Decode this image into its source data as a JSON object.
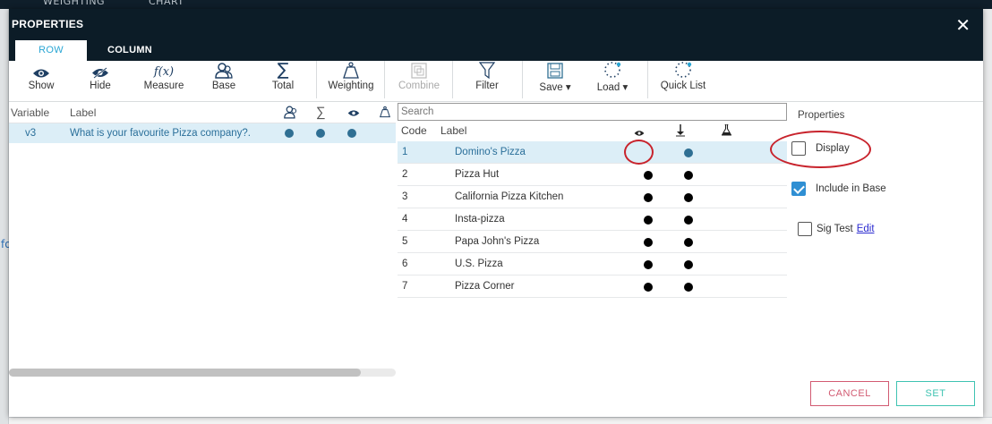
{
  "backdrop": {
    "tabs": [
      "WEIGHTING",
      "CHART"
    ],
    "side_link": "fo"
  },
  "modal": {
    "title": "PROPERTIES",
    "tabs": [
      {
        "label": "ROW",
        "active": true
      },
      {
        "label": "COLUMN",
        "active": false
      }
    ]
  },
  "toolbar": {
    "show": "Show",
    "hide": "Hide",
    "measure": "Measure",
    "measure_icon_text": "f(x)",
    "base": "Base",
    "total": "Total",
    "weighting": "Weighting",
    "combine": "Combine",
    "filter": "Filter",
    "save": "Save ▾",
    "load": "Load ▾",
    "quick_list": "Quick List"
  },
  "variables": {
    "headers": {
      "variable": "Variable",
      "label": "Label"
    },
    "rows": [
      {
        "variable": "v3",
        "label": "What is your favourite Pizza company?."
      }
    ]
  },
  "grid": {
    "search_placeholder": "Search",
    "headers": {
      "code": "Code",
      "label": "Label"
    },
    "rows": [
      {
        "code": "1",
        "label": "Domino's Pizza",
        "selected": true
      },
      {
        "code": "2",
        "label": "Pizza Hut"
      },
      {
        "code": "3",
        "label": "California Pizza Kitchen"
      },
      {
        "code": "4",
        "label": "Insta-pizza"
      },
      {
        "code": "5",
        "label": "Papa John's Pizza"
      },
      {
        "code": "6",
        "label": "U.S. Pizza"
      },
      {
        "code": "7",
        "label": "Pizza Corner"
      }
    ]
  },
  "properties": {
    "title": "Properties",
    "display": {
      "label": "Display",
      "checked": false
    },
    "include_in_base": {
      "label": "Include in Base",
      "checked": true
    },
    "sig_test": {
      "label": "Sig Test",
      "checked": false,
      "edit": "Edit"
    }
  },
  "footer": {
    "cancel": "CANCEL",
    "set": "SET"
  },
  "colors": {
    "header_bg": "#0c1c27",
    "accent": "#2aa6d4",
    "selected_row": "#dceef7",
    "cancel": "#d25b72",
    "set": "#3fc3b2",
    "annotation": "#c8232c"
  }
}
